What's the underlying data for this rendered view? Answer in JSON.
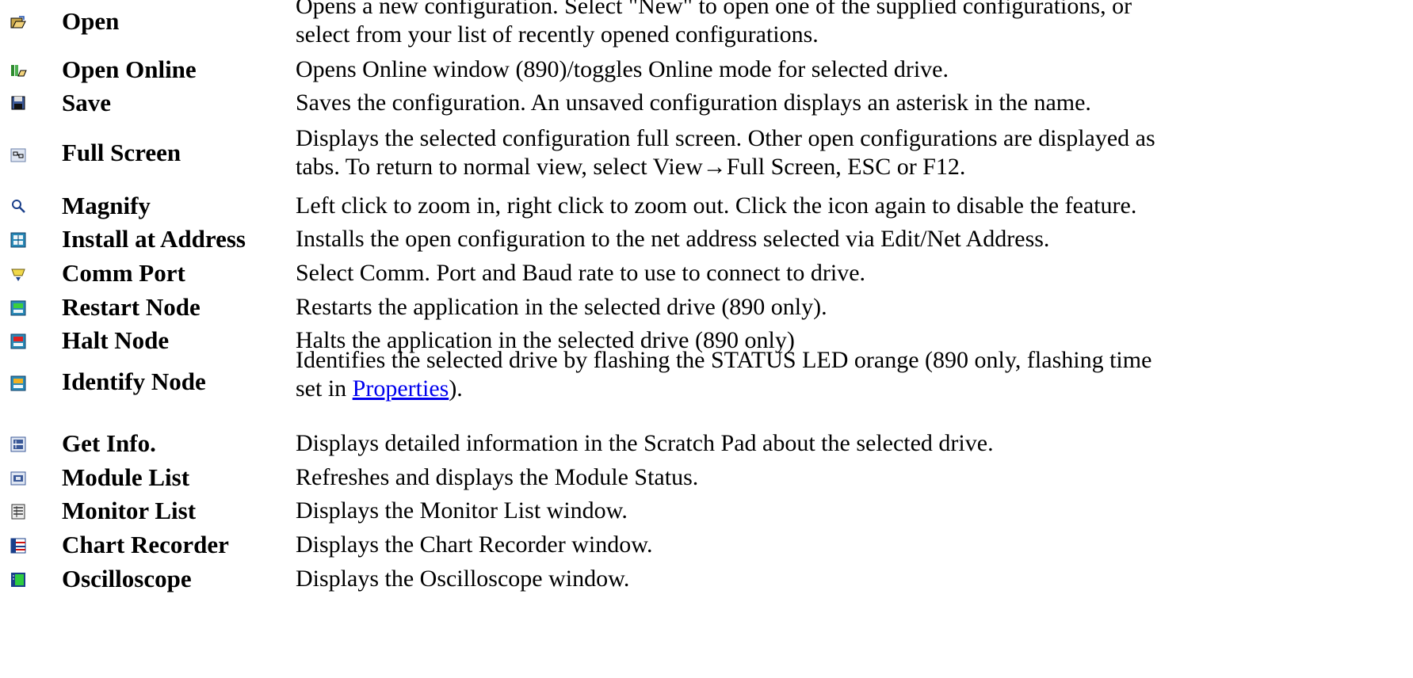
{
  "commands": [
    {
      "icon": "open-folder-icon",
      "name": "Open",
      "desc": [
        "Opens a new configuration. Select \"New\" to open one of the supplied configurations, or",
        "select from your list of recently opened configurations."
      ]
    },
    {
      "icon": "open-online-icon",
      "name": "Open Online",
      "desc": [
        "Opens Online window (890)/toggles Online mode for selected drive."
      ]
    },
    {
      "icon": "save-disk-icon",
      "name": "Save",
      "desc": [
        "Saves the configuration. An unsaved configuration displays an asterisk in the name."
      ]
    },
    {
      "icon": "full-screen-icon",
      "name": "Full Screen",
      "desc": [
        "Displays the selected configuration full screen. Other open configurations are displayed as",
        "tabs. To return to normal view, select View→Full Screen, ESC or F12."
      ]
    },
    {
      "icon": "magnify-icon",
      "name": "Magnify",
      "desc": [
        "Left click to zoom in, right click to zoom out. Click the icon again to disable the feature."
      ]
    },
    {
      "icon": "install-at-address-icon",
      "name": "Install at Address",
      "desc": [
        "Installs the open configuration to the net address selected via Edit/Net Address."
      ]
    },
    {
      "icon": "comm-port-icon",
      "name": "Comm Port",
      "desc": [
        "Select Comm. Port and Baud rate to use to connect to drive."
      ]
    },
    {
      "icon": "restart-node-icon",
      "name": "Restart Node",
      "desc": [
        "Restarts the application in the selected drive (890 only)."
      ]
    },
    {
      "icon": "halt-node-icon",
      "name": "Halt Node",
      "desc": [
        "Halts the application in the selected drive (890 only)"
      ]
    },
    {
      "icon": "identify-node-icon",
      "name": "Identify Node",
      "desc": [
        "Identifies the selected drive by flashing the STATUS LED orange (890 only, flashing time"
      ],
      "desc2_prefix": "set in ",
      "desc2_link": "Properties",
      "desc2_suffix": ")."
    },
    {
      "icon": "get-info-icon",
      "name": "Get Info.",
      "desc": [
        "Displays detailed information in the Scratch Pad about the selected drive."
      ]
    },
    {
      "icon": "module-list-icon",
      "name": "Module List",
      "desc": [
        "Refreshes and displays the Module Status."
      ]
    },
    {
      "icon": "monitor-list-icon",
      "name": "Monitor List",
      "desc": [
        "Displays the Monitor List window."
      ]
    },
    {
      "icon": "chart-recorder-icon",
      "name": "Chart Recorder",
      "desc": [
        "Displays the Chart Recorder window."
      ]
    },
    {
      "icon": "oscilloscope-icon",
      "name": "Oscilloscope",
      "desc": [
        "Displays the Oscilloscope window."
      ]
    }
  ]
}
